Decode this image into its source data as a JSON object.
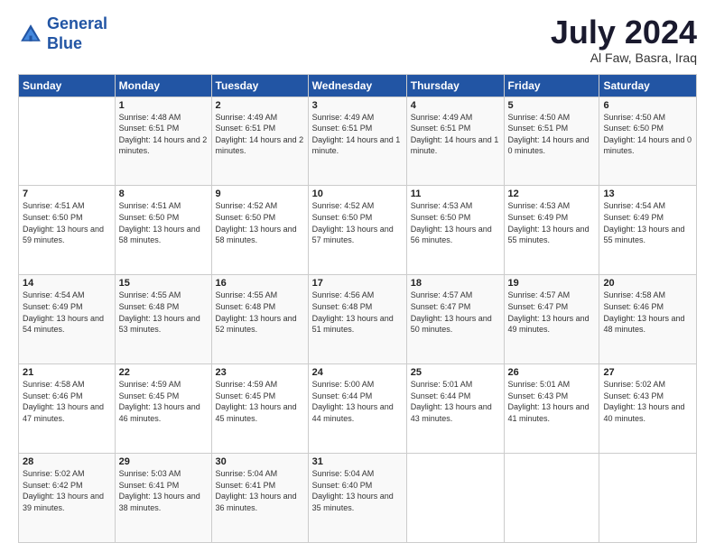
{
  "logo": {
    "line1": "General",
    "line2": "Blue"
  },
  "title": "July 2024",
  "subtitle": "Al Faw, Basra, Iraq",
  "days_header": [
    "Sunday",
    "Monday",
    "Tuesday",
    "Wednesday",
    "Thursday",
    "Friday",
    "Saturday"
  ],
  "weeks": [
    [
      {
        "day": "",
        "sunrise": "",
        "sunset": "",
        "daylight": ""
      },
      {
        "day": "1",
        "sunrise": "Sunrise: 4:48 AM",
        "sunset": "Sunset: 6:51 PM",
        "daylight": "Daylight: 14 hours and 2 minutes."
      },
      {
        "day": "2",
        "sunrise": "Sunrise: 4:49 AM",
        "sunset": "Sunset: 6:51 PM",
        "daylight": "Daylight: 14 hours and 2 minutes."
      },
      {
        "day": "3",
        "sunrise": "Sunrise: 4:49 AM",
        "sunset": "Sunset: 6:51 PM",
        "daylight": "Daylight: 14 hours and 1 minute."
      },
      {
        "day": "4",
        "sunrise": "Sunrise: 4:49 AM",
        "sunset": "Sunset: 6:51 PM",
        "daylight": "Daylight: 14 hours and 1 minute."
      },
      {
        "day": "5",
        "sunrise": "Sunrise: 4:50 AM",
        "sunset": "Sunset: 6:51 PM",
        "daylight": "Daylight: 14 hours and 0 minutes."
      },
      {
        "day": "6",
        "sunrise": "Sunrise: 4:50 AM",
        "sunset": "Sunset: 6:50 PM",
        "daylight": "Daylight: 14 hours and 0 minutes."
      }
    ],
    [
      {
        "day": "7",
        "sunrise": "Sunrise: 4:51 AM",
        "sunset": "Sunset: 6:50 PM",
        "daylight": "Daylight: 13 hours and 59 minutes."
      },
      {
        "day": "8",
        "sunrise": "Sunrise: 4:51 AM",
        "sunset": "Sunset: 6:50 PM",
        "daylight": "Daylight: 13 hours and 58 minutes."
      },
      {
        "day": "9",
        "sunrise": "Sunrise: 4:52 AM",
        "sunset": "Sunset: 6:50 PM",
        "daylight": "Daylight: 13 hours and 58 minutes."
      },
      {
        "day": "10",
        "sunrise": "Sunrise: 4:52 AM",
        "sunset": "Sunset: 6:50 PM",
        "daylight": "Daylight: 13 hours and 57 minutes."
      },
      {
        "day": "11",
        "sunrise": "Sunrise: 4:53 AM",
        "sunset": "Sunset: 6:50 PM",
        "daylight": "Daylight: 13 hours and 56 minutes."
      },
      {
        "day": "12",
        "sunrise": "Sunrise: 4:53 AM",
        "sunset": "Sunset: 6:49 PM",
        "daylight": "Daylight: 13 hours and 55 minutes."
      },
      {
        "day": "13",
        "sunrise": "Sunrise: 4:54 AM",
        "sunset": "Sunset: 6:49 PM",
        "daylight": "Daylight: 13 hours and 55 minutes."
      }
    ],
    [
      {
        "day": "14",
        "sunrise": "Sunrise: 4:54 AM",
        "sunset": "Sunset: 6:49 PM",
        "daylight": "Daylight: 13 hours and 54 minutes."
      },
      {
        "day": "15",
        "sunrise": "Sunrise: 4:55 AM",
        "sunset": "Sunset: 6:48 PM",
        "daylight": "Daylight: 13 hours and 53 minutes."
      },
      {
        "day": "16",
        "sunrise": "Sunrise: 4:55 AM",
        "sunset": "Sunset: 6:48 PM",
        "daylight": "Daylight: 13 hours and 52 minutes."
      },
      {
        "day": "17",
        "sunrise": "Sunrise: 4:56 AM",
        "sunset": "Sunset: 6:48 PM",
        "daylight": "Daylight: 13 hours and 51 minutes."
      },
      {
        "day": "18",
        "sunrise": "Sunrise: 4:57 AM",
        "sunset": "Sunset: 6:47 PM",
        "daylight": "Daylight: 13 hours and 50 minutes."
      },
      {
        "day": "19",
        "sunrise": "Sunrise: 4:57 AM",
        "sunset": "Sunset: 6:47 PM",
        "daylight": "Daylight: 13 hours and 49 minutes."
      },
      {
        "day": "20",
        "sunrise": "Sunrise: 4:58 AM",
        "sunset": "Sunset: 6:46 PM",
        "daylight": "Daylight: 13 hours and 48 minutes."
      }
    ],
    [
      {
        "day": "21",
        "sunrise": "Sunrise: 4:58 AM",
        "sunset": "Sunset: 6:46 PM",
        "daylight": "Daylight: 13 hours and 47 minutes."
      },
      {
        "day": "22",
        "sunrise": "Sunrise: 4:59 AM",
        "sunset": "Sunset: 6:45 PM",
        "daylight": "Daylight: 13 hours and 46 minutes."
      },
      {
        "day": "23",
        "sunrise": "Sunrise: 4:59 AM",
        "sunset": "Sunset: 6:45 PM",
        "daylight": "Daylight: 13 hours and 45 minutes."
      },
      {
        "day": "24",
        "sunrise": "Sunrise: 5:00 AM",
        "sunset": "Sunset: 6:44 PM",
        "daylight": "Daylight: 13 hours and 44 minutes."
      },
      {
        "day": "25",
        "sunrise": "Sunrise: 5:01 AM",
        "sunset": "Sunset: 6:44 PM",
        "daylight": "Daylight: 13 hours and 43 minutes."
      },
      {
        "day": "26",
        "sunrise": "Sunrise: 5:01 AM",
        "sunset": "Sunset: 6:43 PM",
        "daylight": "Daylight: 13 hours and 41 minutes."
      },
      {
        "day": "27",
        "sunrise": "Sunrise: 5:02 AM",
        "sunset": "Sunset: 6:43 PM",
        "daylight": "Daylight: 13 hours and 40 minutes."
      }
    ],
    [
      {
        "day": "28",
        "sunrise": "Sunrise: 5:02 AM",
        "sunset": "Sunset: 6:42 PM",
        "daylight": "Daylight: 13 hours and 39 minutes."
      },
      {
        "day": "29",
        "sunrise": "Sunrise: 5:03 AM",
        "sunset": "Sunset: 6:41 PM",
        "daylight": "Daylight: 13 hours and 38 minutes."
      },
      {
        "day": "30",
        "sunrise": "Sunrise: 5:04 AM",
        "sunset": "Sunset: 6:41 PM",
        "daylight": "Daylight: 13 hours and 36 minutes."
      },
      {
        "day": "31",
        "sunrise": "Sunrise: 5:04 AM",
        "sunset": "Sunset: 6:40 PM",
        "daylight": "Daylight: 13 hours and 35 minutes."
      },
      {
        "day": "",
        "sunrise": "",
        "sunset": "",
        "daylight": ""
      },
      {
        "day": "",
        "sunrise": "",
        "sunset": "",
        "daylight": ""
      },
      {
        "day": "",
        "sunrise": "",
        "sunset": "",
        "daylight": ""
      }
    ]
  ]
}
